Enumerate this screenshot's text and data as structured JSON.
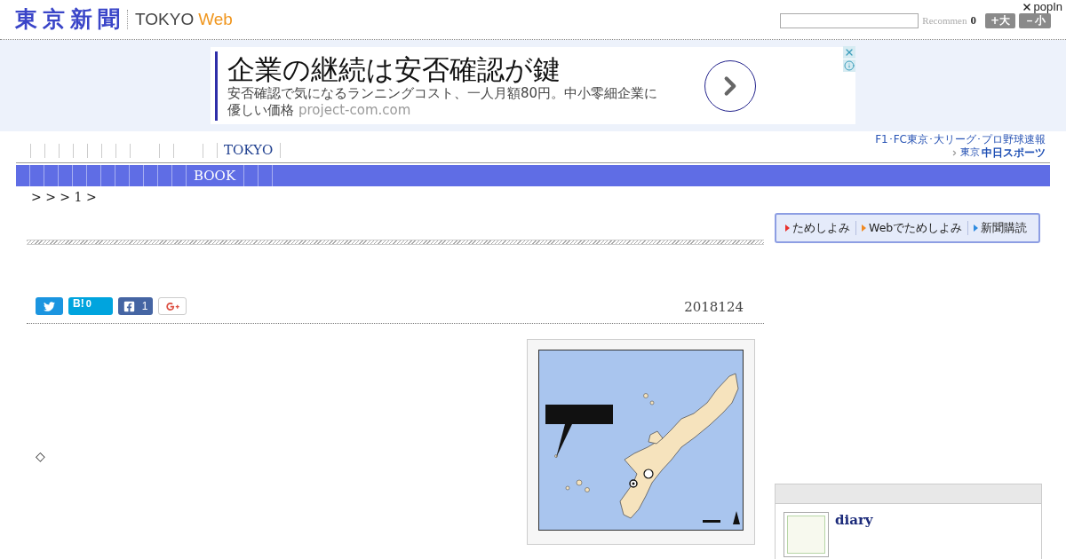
{
  "header": {
    "logo": "東京新聞",
    "site_name": "TOKYO",
    "site_name_accent": "Web",
    "recommend_label": "Recommen",
    "recommend_count": "0",
    "font_buttons": [
      "+大",
      "－小"
    ],
    "popin_label": "popIn"
  },
  "ad": {
    "title": "企業の継続は安否確認が鍵",
    "description": "安否確認で気になるランニングコスト、一人月額80円。中小零細企業に優しい価格",
    "domain": "project-com.com"
  },
  "nav": {
    "top_links": [
      "TOKYO"
    ],
    "sports_banner": {
      "tagline": "F1･FC東京･大リーグ･プロ野球速報",
      "brand_prefix": "東京",
      "brand": "中日スポーツ"
    },
    "section_tabs": [
      "BOOK"
    ]
  },
  "breadcrumb": "> > > 1 >",
  "promo_links": [
    {
      "label": "ためしよみ",
      "color": "#e8312c"
    },
    {
      "label": "Webでためしよみ",
      "color": "#f08a24"
    },
    {
      "label": "新聞購読",
      "color": "#2e8be0"
    }
  ],
  "share_buttons": [
    {
      "kind": "twitter"
    },
    {
      "kind": "hatena",
      "label": "B!",
      "count": "0"
    },
    {
      "kind": "facebook",
      "count": "1"
    },
    {
      "kind": "googleplus"
    }
  ],
  "article": {
    "date": "2018124",
    "marker": "◇"
  },
  "sidebar": {
    "card_title": "diary"
  }
}
